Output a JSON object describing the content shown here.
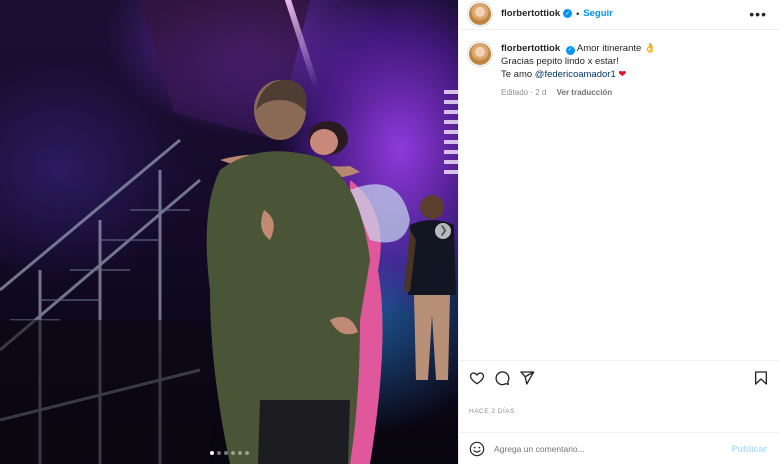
{
  "post": {
    "username": "florbertottiok",
    "follow_label": "Seguir",
    "header_separator": "•",
    "more_label": "•••",
    "caption": {
      "line1": "Amor itinerante",
      "line2": "Gracias pepito lindo x estar!",
      "line3_prefix": "Te amo",
      "mention": "@federicoamador1",
      "edited": "Editado · 2 d",
      "translate_label": "Ver traducción"
    },
    "posted_ago": "HACE 2 DÍAS",
    "comment_placeholder": "Agrega un comentario...",
    "publish_label": "Publicar",
    "carousel": {
      "slides": 6,
      "active_index": 0
    }
  },
  "icons": {
    "heart": "heart-icon",
    "comment": "comment-icon",
    "share": "share-icon",
    "save": "bookmark-icon",
    "emoji": "emoji-icon",
    "verified": "verified-badge-icon",
    "next": "chevron-right-icon"
  },
  "colors": {
    "accent": "#0095f6",
    "publish_disabled": "#b2dffc",
    "verified": "#0095f6"
  }
}
